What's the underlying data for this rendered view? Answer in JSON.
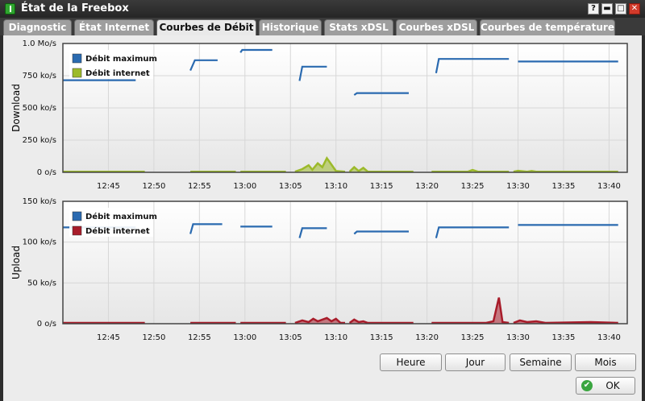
{
  "window": {
    "title": "État de la Freebox"
  },
  "tabs": [
    {
      "label": "Diagnostic",
      "active": false
    },
    {
      "label": "État Internet",
      "active": false
    },
    {
      "label": "Courbes de Débit",
      "active": true
    },
    {
      "label": "Historique",
      "active": false
    },
    {
      "label": "Stats xDSL",
      "active": false
    },
    {
      "label": "Courbes xDSL",
      "active": false
    },
    {
      "label": "Courbes de température",
      "active": false
    }
  ],
  "buttons": {
    "hour": "Heure",
    "day": "Jour",
    "week": "Semaine",
    "month": "Mois",
    "ok": "OK"
  },
  "colors": {
    "max_line": "#2a6ab0",
    "download": "#9cba2a",
    "upload": "#a81c2a"
  },
  "chart_data": [
    {
      "type": "line",
      "ylabel": "Download",
      "ylim": [
        0,
        1000
      ],
      "yticks": [
        0,
        250,
        500,
        750,
        1000
      ],
      "yticklabels": [
        "0 o/s",
        "250 ko/s",
        "500 ko/s",
        "750 ko/s",
        "1.0 Mo/s"
      ],
      "xlim": [
        "12:40",
        "13:42"
      ],
      "xticklabels": [
        "12:45",
        "12:50",
        "12:55",
        "13:00",
        "13:05",
        "13:10",
        "13:15",
        "13:20",
        "13:25",
        "13:30",
        "13:35",
        "13:40"
      ],
      "legend": {
        "placement": "top-left",
        "entries": [
          "Débit maximum",
          "Débit internet"
        ]
      },
      "series": [
        {
          "name": "Débit maximum",
          "segments": [
            [
              [
                "12:40",
                715
              ],
              [
                "12:48",
                715
              ]
            ],
            [
              [
                "12:54",
                790
              ],
              [
                "12:54.5",
                870
              ],
              [
                "12:57",
                870
              ]
            ],
            [
              [
                "12:59.5",
                930
              ],
              [
                "12:59.7",
                950
              ],
              [
                "13:03",
                950
              ]
            ],
            [
              [
                "13:06",
                710
              ],
              [
                "13:06.3",
                820
              ],
              [
                "13:09",
                820
              ]
            ],
            [
              [
                "13:12",
                600
              ],
              [
                "13:12.3",
                615
              ],
              [
                "13:18",
                615
              ]
            ],
            [
              [
                "13:21",
                770
              ],
              [
                "13:21.3",
                880
              ],
              [
                "13:29",
                880
              ]
            ],
            [
              [
                "13:30",
                860
              ],
              [
                "13:41",
                860
              ]
            ]
          ]
        },
        {
          "name": "Débit internet",
          "segments": [
            [
              [
                "12:40",
                5
              ],
              [
                "12:49",
                5
              ]
            ],
            [
              [
                "12:54",
                5
              ],
              [
                "12:59",
                5
              ]
            ],
            [
              [
                "12:59.5",
                5
              ],
              [
                "13:04.5",
                5
              ]
            ],
            [
              [
                "13:05.5",
                5
              ],
              [
                "13:06.3",
                25
              ],
              [
                "13:07",
                55
              ],
              [
                "13:07.4",
                20
              ],
              [
                "13:08",
                70
              ],
              [
                "13:08.5",
                40
              ],
              [
                "13:09",
                110
              ],
              [
                "13:09.5",
                60
              ],
              [
                "13:10",
                10
              ],
              [
                "13:11",
                5
              ]
            ],
            [
              [
                "13:11.5",
                5
              ],
              [
                "13:12",
                40
              ],
              [
                "13:12.5",
                10
              ],
              [
                "13:13",
                35
              ],
              [
                "13:13.5",
                5
              ],
              [
                "13:18.5",
                5
              ]
            ],
            [
              [
                "13:20.5",
                5
              ],
              [
                "13:24.5",
                5
              ],
              [
                "13:25",
                18
              ],
              [
                "13:25.6",
                5
              ],
              [
                "13:29",
                5
              ]
            ],
            [
              [
                "13:29.5",
                5
              ],
              [
                "13:30",
                12
              ],
              [
                "13:31",
                5
              ],
              [
                "13:31.5",
                10
              ],
              [
                "13:32",
                5
              ],
              [
                "13:41",
                5
              ]
            ]
          ]
        }
      ]
    },
    {
      "type": "line",
      "ylabel": "Upload",
      "ylim": [
        0,
        150
      ],
      "yticks": [
        0,
        50,
        100,
        150
      ],
      "yticklabels": [
        "0 o/s",
        "50 ko/s",
        "100 ko/s",
        "150 ko/s"
      ],
      "xlim": [
        "12:40",
        "13:42"
      ],
      "xticklabels": [
        "12:45",
        "12:50",
        "12:55",
        "13:00",
        "13:05",
        "13:10",
        "13:15",
        "13:20",
        "13:25",
        "13:30",
        "13:35",
        "13:40"
      ],
      "legend": {
        "placement": "top-left",
        "entries": [
          "Débit maximum",
          "Débit internet"
        ]
      },
      "series": [
        {
          "name": "Débit maximum",
          "segments": [
            [
              [
                "12:40",
                118
              ],
              [
                "12:48",
                118
              ]
            ],
            [
              [
                "12:54",
                110
              ],
              [
                "12:54.3",
                122
              ],
              [
                "12:57.5",
                122
              ]
            ],
            [
              [
                "12:59.5",
                119
              ],
              [
                "13:03",
                119
              ]
            ],
            [
              [
                "13:06",
                105
              ],
              [
                "13:06.3",
                117
              ],
              [
                "13:09",
                117
              ]
            ],
            [
              [
                "13:12",
                110
              ],
              [
                "13:12.3",
                113
              ],
              [
                "13:18",
                113
              ]
            ],
            [
              [
                "13:21",
                105
              ],
              [
                "13:21.3",
                118
              ],
              [
                "13:29",
                118
              ]
            ],
            [
              [
                "13:30",
                121
              ],
              [
                "13:41",
                121
              ]
            ]
          ]
        },
        {
          "name": "Débit internet",
          "segments": [
            [
              [
                "12:40",
                1
              ],
              [
                "12:49",
                1
              ]
            ],
            [
              [
                "12:54",
                1
              ],
              [
                "12:59",
                1
              ]
            ],
            [
              [
                "12:59.5",
                1
              ],
              [
                "13:04.5",
                1
              ]
            ],
            [
              [
                "13:05.5",
                1
              ],
              [
                "13:06.3",
                4
              ],
              [
                "13:07",
                2
              ],
              [
                "13:07.5",
                6
              ],
              [
                "13:08",
                3
              ],
              [
                "13:08.5",
                5
              ],
              [
                "13:09",
                7
              ],
              [
                "13:09.5",
                3
              ],
              [
                "13:10",
                6
              ],
              [
                "13:10.5",
                1
              ],
              [
                "13:11",
                1
              ]
            ],
            [
              [
                "13:11.5",
                1
              ],
              [
                "13:12",
                5
              ],
              [
                "13:12.5",
                2
              ],
              [
                "13:13",
                3
              ],
              [
                "13:13.5",
                1
              ],
              [
                "13:18.5",
                1
              ]
            ],
            [
              [
                "13:20.5",
                1
              ],
              [
                "13:26.5",
                1
              ],
              [
                "13:27.3",
                3
              ],
              [
                "13:27.9",
                32
              ],
              [
                "13:28.3",
                2
              ],
              [
                "13:29",
                1
              ]
            ],
            [
              [
                "13:29.5",
                1
              ],
              [
                "13:30.2",
                4
              ],
              [
                "13:31",
                2
              ],
              [
                "13:32",
                3
              ],
              [
                "13:33",
                1
              ],
              [
                "13:38",
                2
              ],
              [
                "13:41",
                1
              ]
            ]
          ]
        }
      ]
    }
  ]
}
